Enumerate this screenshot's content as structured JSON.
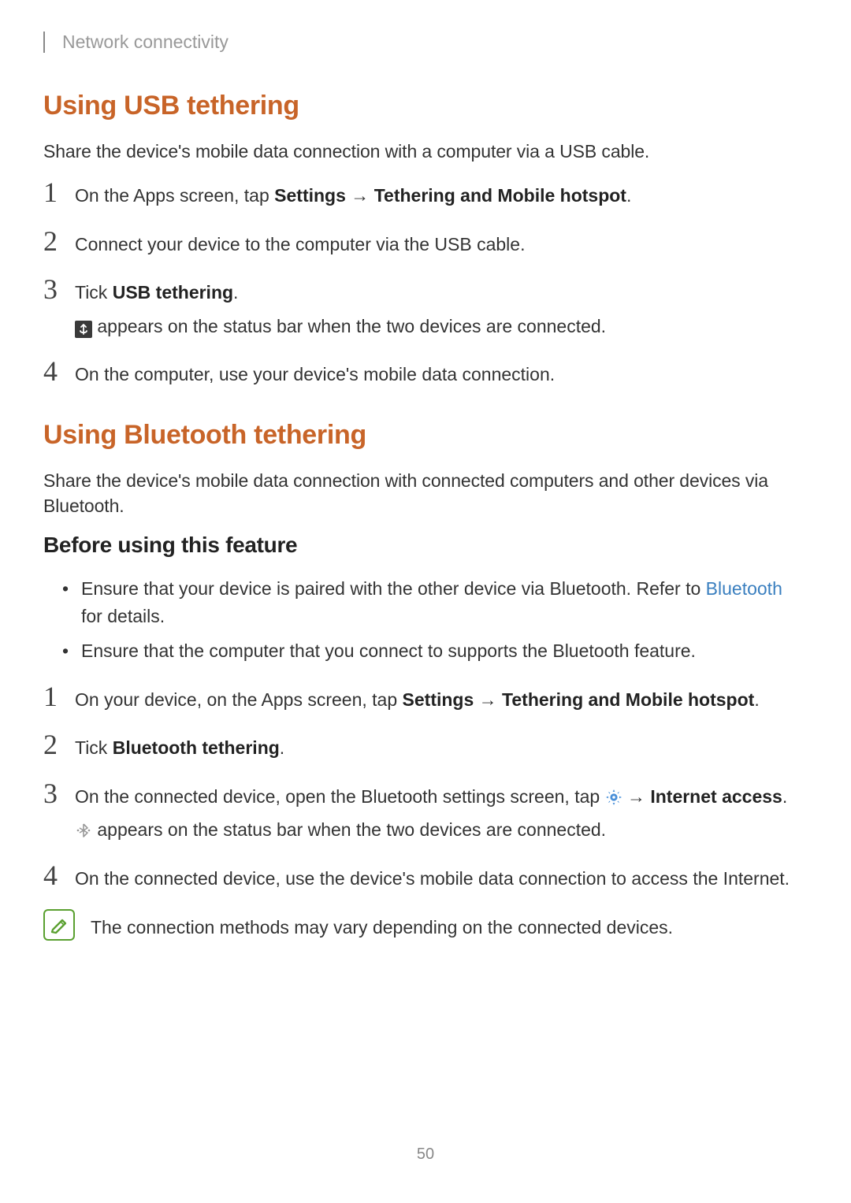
{
  "header": {
    "breadcrumb": "Network connectivity"
  },
  "usb": {
    "title": "Using USB tethering",
    "intro": "Share the device's mobile data connection with a computer via a USB cable.",
    "steps": {
      "n1": "1",
      "t1a": "On the Apps screen, tap ",
      "t1b": "Settings",
      "t1c": " → ",
      "t1d": "Tethering and Mobile hotspot",
      "t1e": ".",
      "n2": "2",
      "t2": "Connect your device to the computer via the USB cable.",
      "n3": "3",
      "t3a": "Tick ",
      "t3b": "USB tethering",
      "t3c": ".",
      "t3_sub_a": " appears on the status bar when the two devices are connected.",
      "n4": "4",
      "t4": "On the computer, use your device's mobile data connection."
    }
  },
  "bt": {
    "title": "Using Bluetooth tethering",
    "intro": "Share the device's mobile data connection with connected computers and other devices via Bluetooth.",
    "before_title": "Before using this feature",
    "bullets": {
      "b1a": "Ensure that your device is paired with the other device via Bluetooth. Refer to ",
      "b1_link": "Bluetooth",
      "b1b": " for details.",
      "b2": "Ensure that the computer that you connect to supports the Bluetooth feature."
    },
    "steps": {
      "n1": "1",
      "t1a": "On your device, on the Apps screen, tap ",
      "t1b": "Settings",
      "t1c": " → ",
      "t1d": "Tethering and Mobile hotspot",
      "t1e": ".",
      "n2": "2",
      "t2a": "Tick ",
      "t2b": "Bluetooth tethering",
      "t2c": ".",
      "n3": "3",
      "t3a": "On the connected device, open the Bluetooth settings screen, tap ",
      "t3b": " → ",
      "t3c": "Internet access",
      "t3d": ".",
      "t3_sub_a": " appears on the status bar when the two devices are connected.",
      "n4": "4",
      "t4": "On the connected device, use the device's mobile data connection to access the Internet."
    },
    "note": "The connection methods may vary depending on the connected devices."
  },
  "page_number": "50"
}
